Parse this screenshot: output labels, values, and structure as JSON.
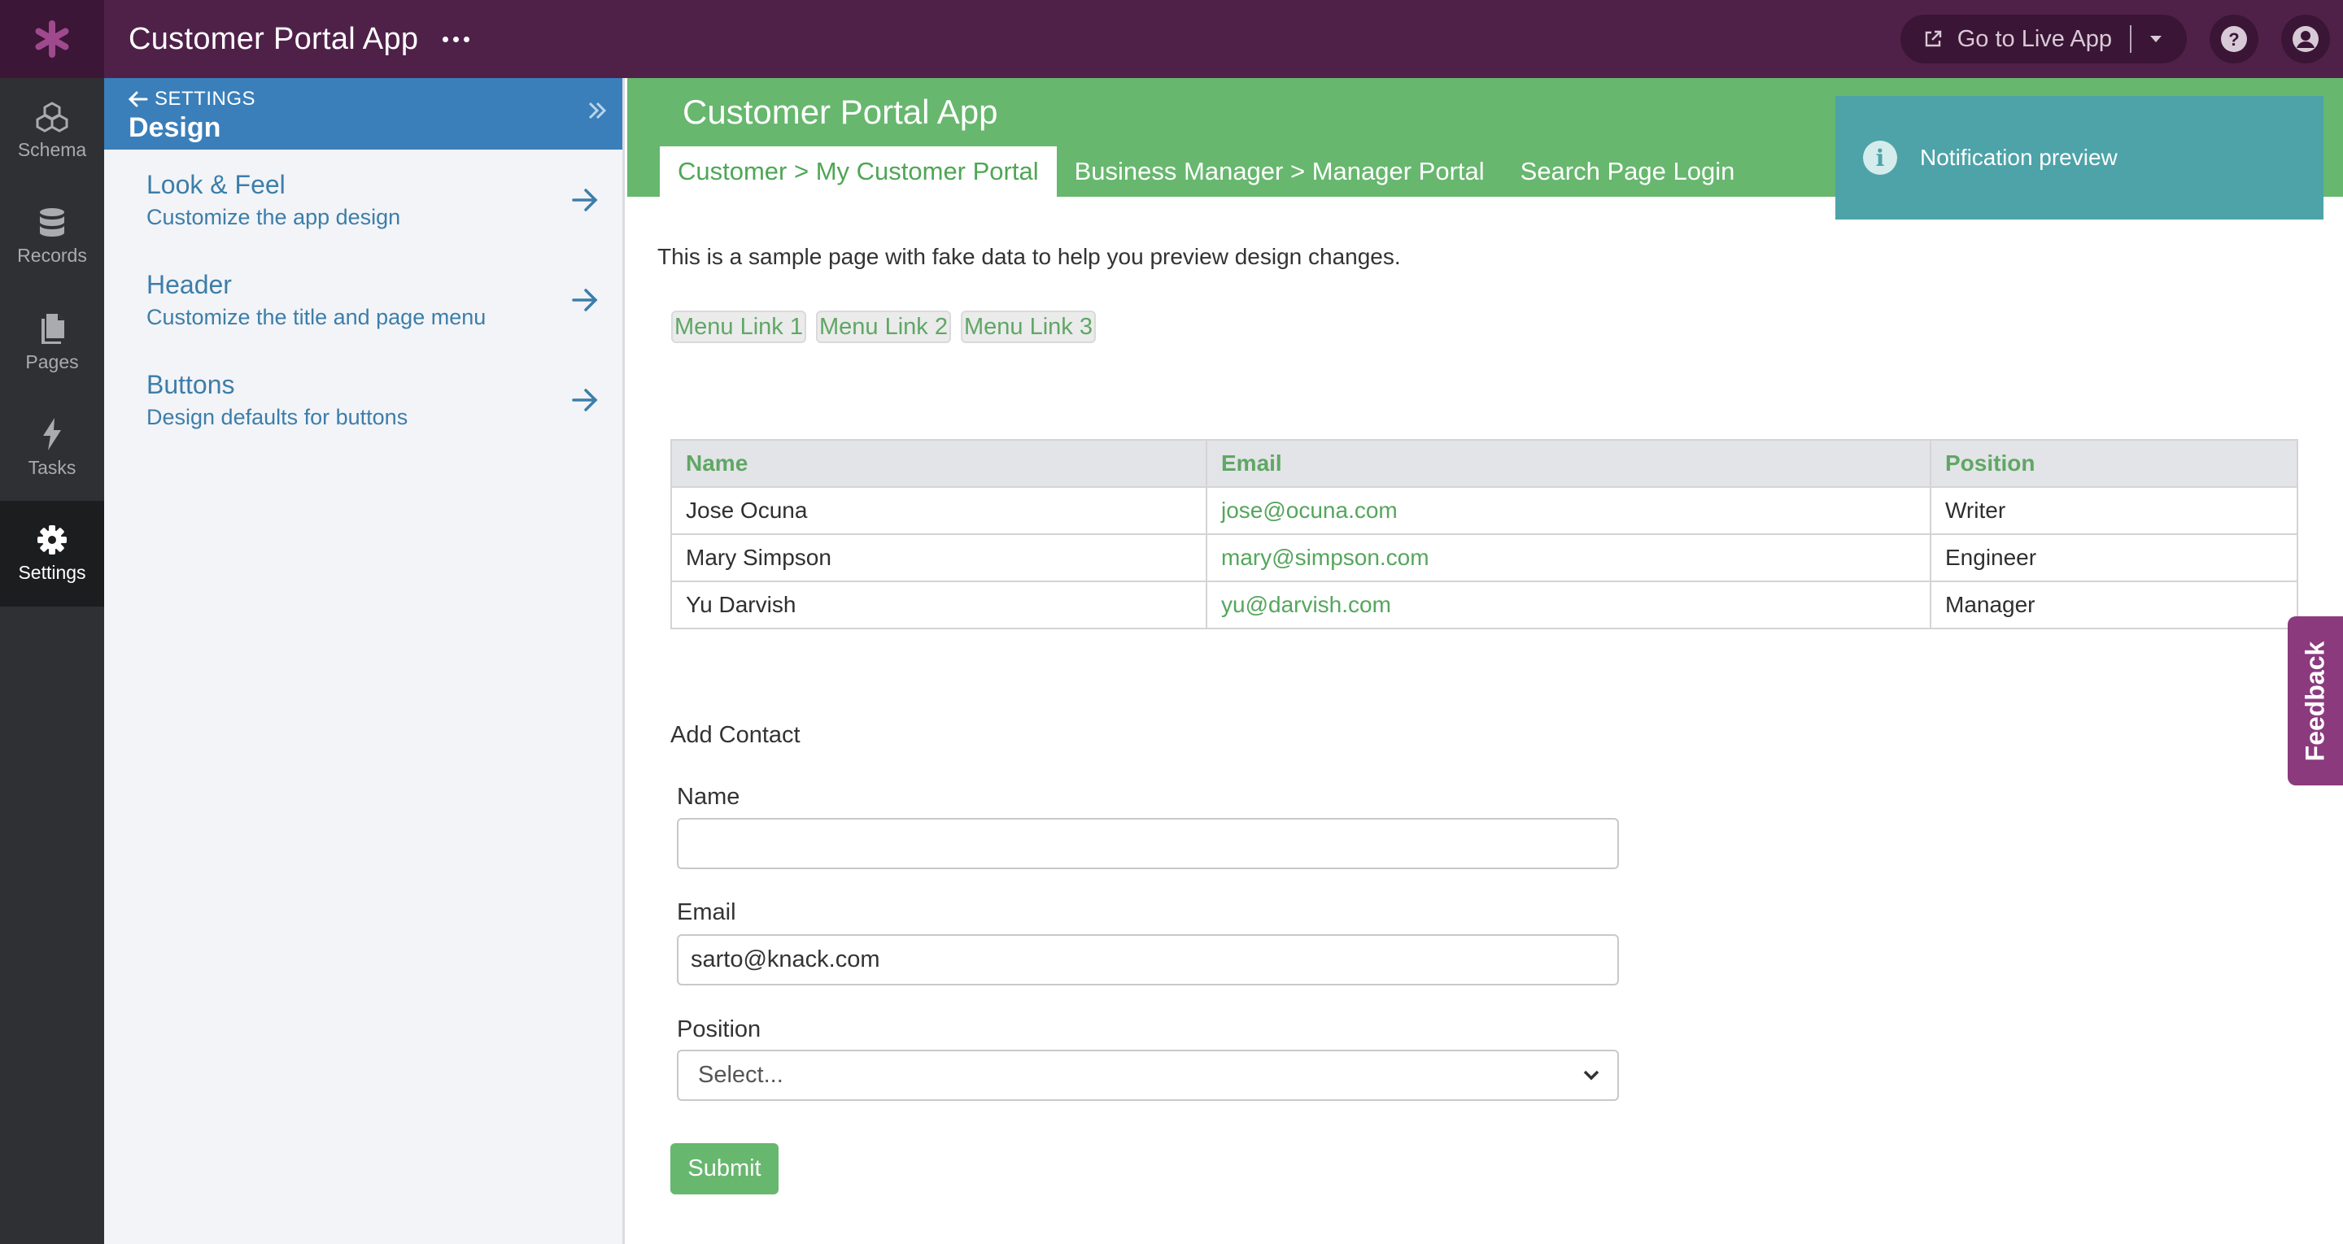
{
  "topbar": {
    "app_title": "Customer Portal App",
    "live_app_label": "Go to Live App",
    "colors": {
      "background": "#4f2149",
      "logo_box": "#3b1636",
      "logo": "#a0498e"
    },
    "icons": [
      "asterisk-logo",
      "more-dots-icon",
      "external-link-icon",
      "caret-down-icon",
      "help-icon",
      "user-icon"
    ]
  },
  "leftnav": {
    "items": [
      {
        "label": "Schema",
        "icon": "cubes-icon"
      },
      {
        "label": "Records",
        "icon": "database-icon"
      },
      {
        "label": "Pages",
        "icon": "pages-icon"
      },
      {
        "label": "Tasks",
        "icon": "lightning-icon"
      },
      {
        "label": "Settings",
        "icon": "gear-icon",
        "active": true
      }
    ]
  },
  "settings_panel": {
    "back_label": "SETTINGS",
    "title": "Design",
    "links": [
      {
        "title": "Look & Feel",
        "subtitle": "Customize the app design"
      },
      {
        "title": "Header",
        "subtitle": "Customize the title and page menu"
      },
      {
        "title": "Buttons",
        "subtitle": "Design defaults for buttons"
      }
    ]
  },
  "preview": {
    "app_title": "Customer Portal App",
    "tabs": [
      {
        "label": "Customer > My Customer Portal",
        "active": true
      },
      {
        "label": "Business Manager > Manager Portal"
      },
      {
        "label": "Search Page Login"
      }
    ],
    "notification": "Notification preview",
    "intro": "This is a sample page with fake data to help you preview design changes.",
    "menu_links": [
      "Menu Link 1",
      "Menu Link 2",
      "Menu Link 3"
    ],
    "table": {
      "headers": [
        "Name",
        "Email",
        "Position"
      ],
      "rows": [
        [
          "Jose Ocuna",
          "jose@ocuna.com",
          "Writer"
        ],
        [
          "Mary Simpson",
          "mary@simpson.com",
          "Engineer"
        ],
        [
          "Yu Darvish",
          "yu@darvish.com",
          "Manager"
        ]
      ]
    },
    "form": {
      "title": "Add Contact",
      "name_label": "Name",
      "name_value": "",
      "email_label": "Email",
      "email_value": "sarto@knack.com",
      "position_label": "Position",
      "position_value": "Select...",
      "submit_label": "Submit"
    },
    "colors": {
      "accent": "#67b76e",
      "notification": "#4da3a8",
      "feedback": "#8b3a7e"
    }
  },
  "feedback_label": "Feedback"
}
